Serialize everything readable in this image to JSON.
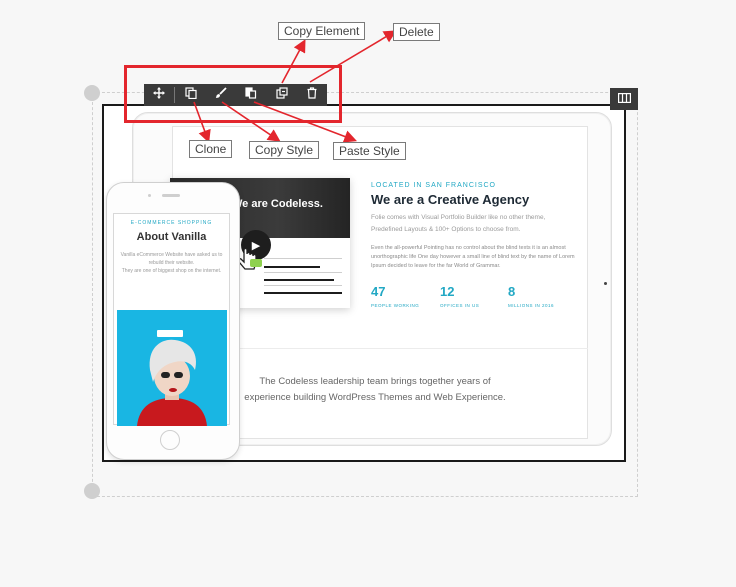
{
  "toolbar": {
    "buttons": [
      "move",
      "clone",
      "copy-style",
      "paste-style",
      "copy-element",
      "delete"
    ],
    "icons": {
      "move": "move-icon",
      "clone": "clone-icon",
      "copy_style": "brush-icon",
      "paste_style": "paste-style-icon",
      "copy_element": "copy-element-icon",
      "delete": "trash-icon",
      "columns": "columns-icon"
    }
  },
  "callouts": {
    "copy_element": "Copy Element",
    "delete": "Delete",
    "clone": "Clone",
    "copy_style": "Copy Style",
    "paste_style": "Paste Style"
  },
  "preview": {
    "video_title": "We are Codeless.",
    "located": "LOCATED IN SAN FRANCISCO",
    "agency_title": "We are a Creative Agency",
    "agency_sub": "Folie comes with Visual Portfolio Builder like no other theme, Predefined Layouts & 100+ Options to choose from.",
    "agency_body": "Even the all-powerful Pointing has no control about the blind texts it is an almost unorthographic life One day however a small line of blind text by the name of Lorem Ipsum decided to leave for the far World of Grammar.",
    "stats": [
      {
        "number": "47",
        "label": "PEOPLE WORKING"
      },
      {
        "number": "12",
        "label": "OFFICES IN US"
      },
      {
        "number": "8",
        "label": "MILLIONS IN 2016"
      }
    ],
    "leadership_line1": "The Codeless leadership team brings together years of",
    "leadership_line2": "experience building WordPress Themes and Web Experience."
  },
  "phone": {
    "shop_label": "E-COMMERCE SHOPPING",
    "shop_title": "About Vanilla",
    "shop_desc_1": "Vanilla eCommerce Website have asked us to rebuild their website.",
    "shop_desc_2": "They are one of biggest shop on the internet."
  },
  "colors": {
    "accent": "#22a8c4",
    "highlight": "#e3262d",
    "toolbar": "#3a3a3a",
    "phone_image_bg": "#19b6e3"
  }
}
